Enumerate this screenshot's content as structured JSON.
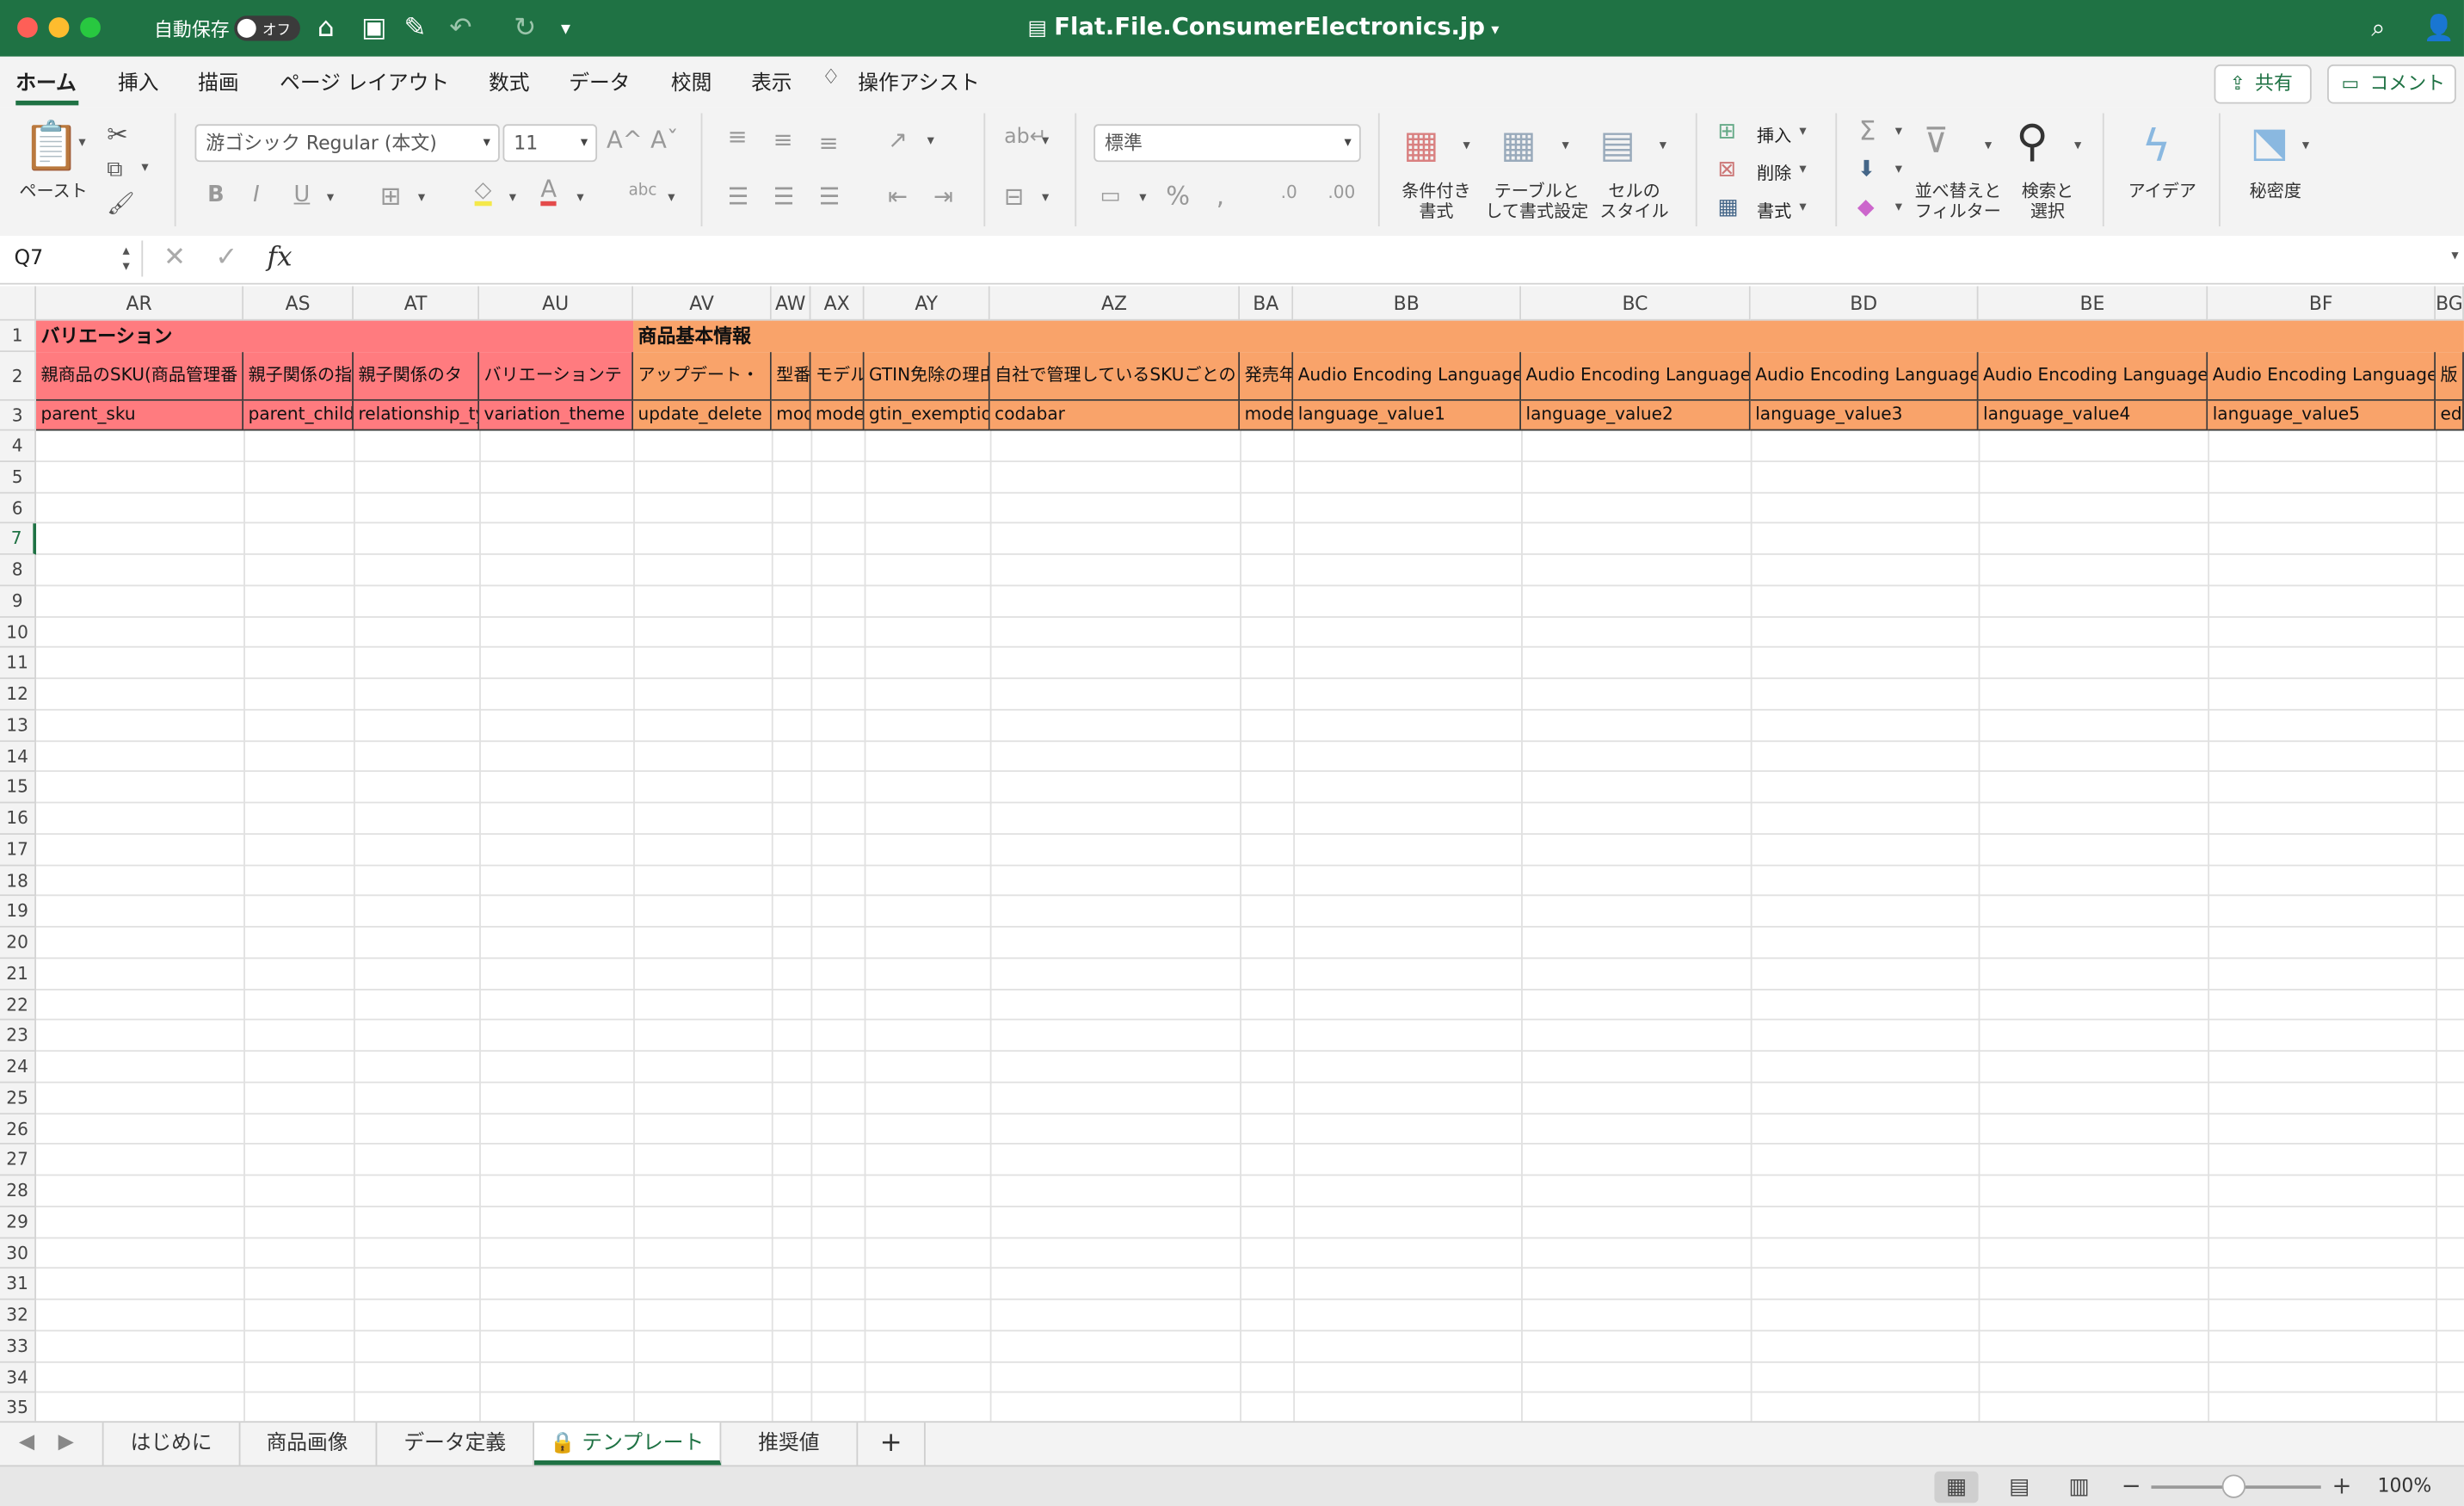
{
  "titlebar": {
    "autosave_label": "自動保存",
    "autosave_state": "オフ",
    "doc_title": "Flat.File.ConsumerElectronics.jp"
  },
  "tabs": [
    "ホーム",
    "挿入",
    "描画",
    "ページ レイアウト",
    "数式",
    "データ",
    "校閲",
    "表示",
    "操作アシスト"
  ],
  "share_label": "共有",
  "comment_label": "コメント",
  "ribbon": {
    "paste": "ペースト",
    "font_name": "游ゴシック Regular (本文)",
    "font_size": "11",
    "number_format": "標準",
    "cond_format": [
      "条件付き",
      "書式"
    ],
    "table_format": [
      "テーブルと",
      "して書式設定"
    ],
    "cell_style": [
      "セルの",
      "スタイル"
    ],
    "insert": "挿入",
    "delete": "削除",
    "format": "書式",
    "sort_filter": [
      "並べ替えと",
      "フィルター"
    ],
    "find_select": [
      "検索と",
      "選択"
    ],
    "ideas": "アイデア",
    "sensitivity": "秘密度"
  },
  "formula_bar": {
    "name_box": "Q7",
    "fx": "fx"
  },
  "columns": [
    "AR",
    "AS",
    "AT",
    "AU",
    "AV",
    "AW",
    "AX",
    "AY",
    "AZ",
    "BA",
    "BB",
    "BC",
    "BD",
    "BE",
    "BF",
    "BG"
  ],
  "rows": [
    "1",
    "2",
    "3",
    "4",
    "5",
    "6",
    "7",
    "8",
    "9",
    "10",
    "11",
    "12",
    "13",
    "14",
    "15",
    "16",
    "17",
    "18",
    "19",
    "20",
    "21",
    "22",
    "23",
    "24",
    "25",
    "26",
    "27",
    "28",
    "29",
    "30",
    "31",
    "32",
    "33",
    "34",
    "35"
  ],
  "row1": {
    "variation": "バリエーション",
    "basic_info": "商品基本情報"
  },
  "row2": [
    "親商品のSKU(商品管理番",
    "親子関係の指",
    "親子関係のタ",
    "バリエーションテ",
    "アップデート・",
    "型番",
    "モデル",
    "GTIN免除の理由",
    "自社で管理しているSKUごとの",
    "発売年",
    "Audio Encoding Language",
    "Audio Encoding Language",
    "Audio Encoding Language",
    "Audio Encoding Language",
    "Audio Encoding Language",
    "版"
  ],
  "row3": [
    "parent_sku",
    "parent_child",
    "relationship_ty",
    "variation_theme",
    "update_delete",
    "mod",
    "model",
    "gtin_exemption",
    "codabar",
    "model",
    "language_value1",
    "language_value2",
    "language_value3",
    "language_value4",
    "language_value5",
    "ed"
  ],
  "sheets": [
    "はじめに",
    "商品画像",
    "データ定義",
    "テンプレート",
    "推奨値"
  ],
  "active_sheet": "テンプレート",
  "zoom": "100%",
  "colors": {
    "excel_green": "#1f7244",
    "variation_pink": "#ff7b7f",
    "basic_orange": "#f9a36a"
  }
}
